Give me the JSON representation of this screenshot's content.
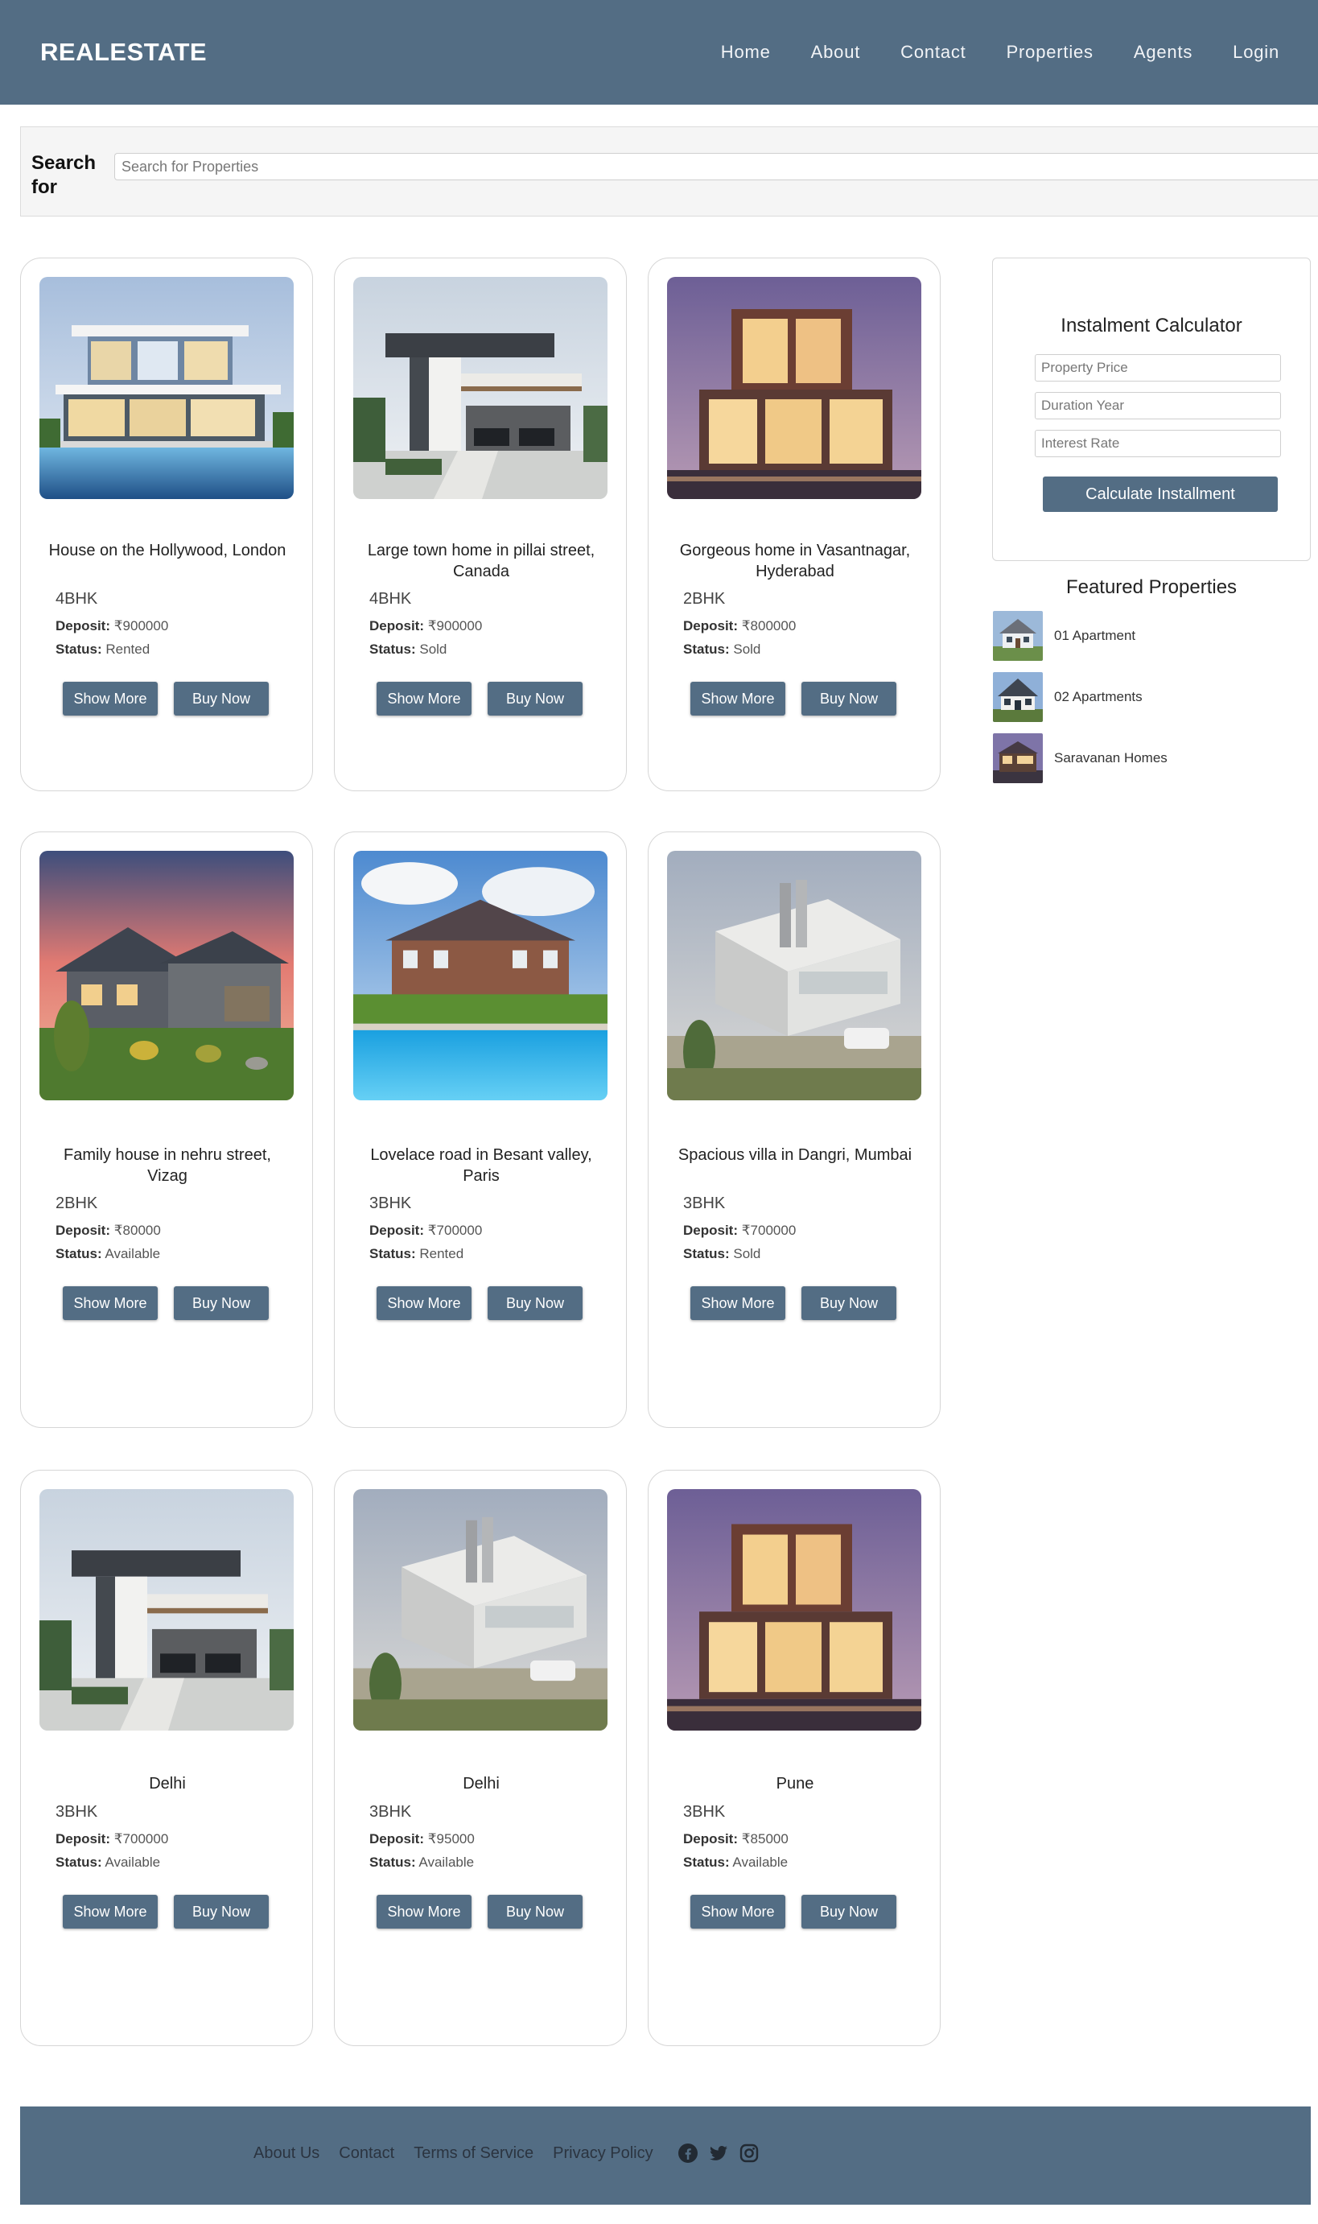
{
  "navbar": {
    "brand": "REALESTATE",
    "links": [
      "Home",
      "About",
      "Contact",
      "Properties",
      "Agents",
      "Login"
    ]
  },
  "search": {
    "label": "Search for",
    "placeholder": "Search for Properties"
  },
  "properties": [
    {
      "title": "House on the Hollywood, London",
      "type": "4BHK",
      "deposit": "₹900000",
      "status": "Rented",
      "image": "modern-villa-pool"
    },
    {
      "title": "Large town home in pillai street, Canada",
      "type": "4BHK",
      "deposit": "₹900000",
      "status": "Sold",
      "image": "modern-townhome"
    },
    {
      "title": "Gorgeous home in Vasantnagar, Hyderabad",
      "type": "2BHK",
      "deposit": "₹800000",
      "status": "Sold",
      "image": "cube-house-dusk"
    },
    {
      "title": "Family house in nehru street, Vizag",
      "type": "2BHK",
      "deposit": "₹80000",
      "status": "Available",
      "image": "family-house-sunset"
    },
    {
      "title": "Lovelace road in Besant valley, Paris",
      "type": "3BHK",
      "deposit": "₹700000",
      "status": "Rented",
      "image": "brick-mansion-pool"
    },
    {
      "title": "Spacious villa in Dangri, Mumbai",
      "type": "3BHK",
      "deposit": "₹700000",
      "status": "Sold",
      "image": "white-villa"
    },
    {
      "title": "Delhi",
      "type": "3BHK",
      "deposit": "₹700000",
      "status": "Available",
      "image": "modern-townhome"
    },
    {
      "title": "Delhi",
      "type": "3BHK",
      "deposit": "₹95000",
      "status": "Available",
      "image": "white-villa"
    },
    {
      "title": "Pune",
      "type": "3BHK",
      "deposit": "₹85000",
      "status": "Available",
      "image": "cube-house-dusk"
    }
  ],
  "card_labels": {
    "deposit": "Deposit:",
    "status": "Status:",
    "show_more": "Show More",
    "buy_now": "Buy Now"
  },
  "calculator": {
    "title": "Instalment Calculator",
    "price_placeholder": "Property Price",
    "duration_placeholder": "Duration Year",
    "rate_placeholder": "Interest Rate",
    "button": "Calculate Installment"
  },
  "featured": {
    "title": "Featured Properties",
    "items": [
      "01 Apartment",
      "02 Apartments",
      "Saravanan Homes"
    ]
  },
  "footer": {
    "links": [
      "About Us",
      "Contact",
      "Terms of Service",
      "Privacy Policy"
    ],
    "social_icons": [
      "facebook-icon",
      "twitter-icon",
      "instagram-icon"
    ]
  },
  "colors": {
    "primary": "#536d84",
    "background": "#ffffff"
  }
}
